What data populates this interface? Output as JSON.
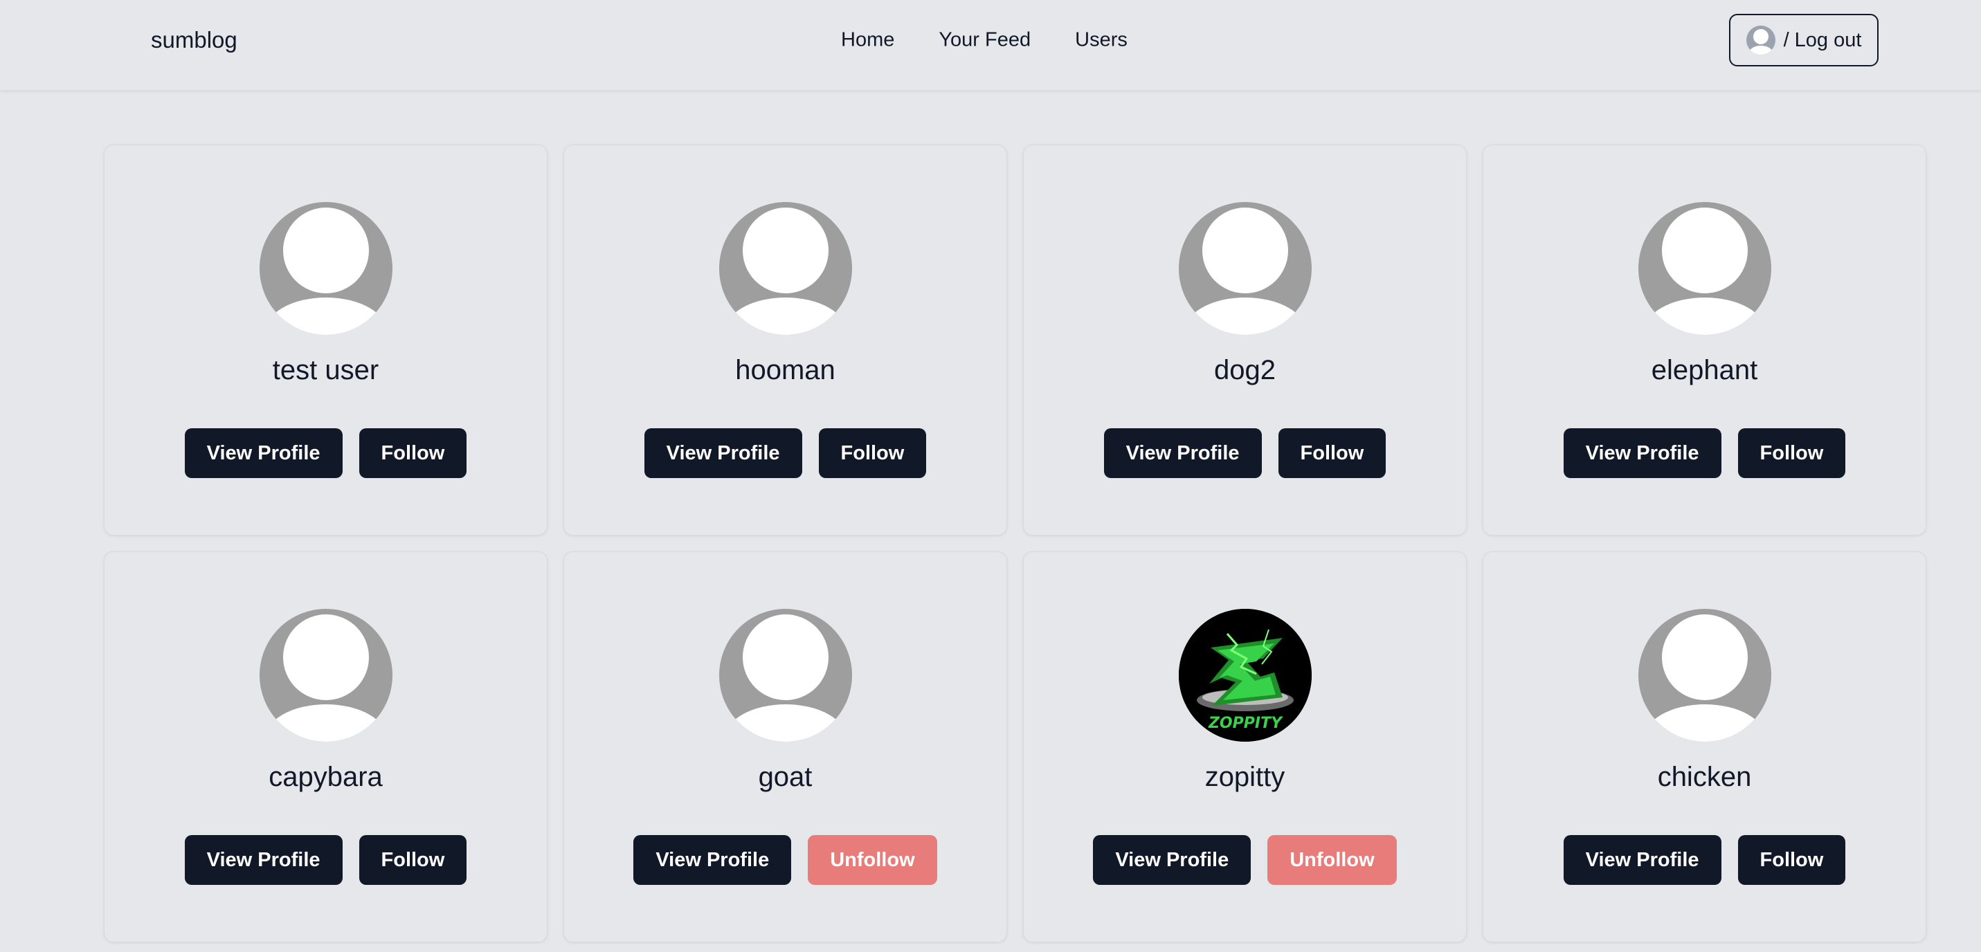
{
  "brand": "sumblog",
  "nav": {
    "links": [
      "Home",
      "Your Feed",
      "Users"
    ]
  },
  "account": {
    "logout_label": "/ Log out"
  },
  "colors": {
    "background": "#e5e7eb",
    "primary_button": "#111827",
    "unfollow_button": "#e87c7a"
  },
  "users": [
    {
      "name": "test user",
      "view_label": "View Profile",
      "follow_label": "Follow",
      "following": false,
      "avatar": "default-avatar-icon"
    },
    {
      "name": "hooman",
      "view_label": "View Profile",
      "follow_label": "Follow",
      "following": false,
      "avatar": "default-avatar-icon"
    },
    {
      "name": "dog2",
      "view_label": "View Profile",
      "follow_label": "Follow",
      "following": false,
      "avatar": "default-avatar-icon"
    },
    {
      "name": "elephant",
      "view_label": "View Profile",
      "follow_label": "Follow",
      "following": false,
      "avatar": "default-avatar-icon"
    },
    {
      "name": "capybara",
      "view_label": "View Profile",
      "follow_label": "Follow",
      "following": false,
      "avatar": "default-avatar-icon"
    },
    {
      "name": "goat",
      "view_label": "View Profile",
      "follow_label": "Unfollow",
      "following": true,
      "avatar": "default-avatar-icon"
    },
    {
      "name": "zopitty",
      "view_label": "View Profile",
      "follow_label": "Unfollow",
      "following": true,
      "avatar": "zopitty-logo",
      "avatar_text": "ZOPPITY"
    },
    {
      "name": "chicken",
      "view_label": "View Profile",
      "follow_label": "Follow",
      "following": false,
      "avatar": "default-avatar-icon"
    }
  ]
}
